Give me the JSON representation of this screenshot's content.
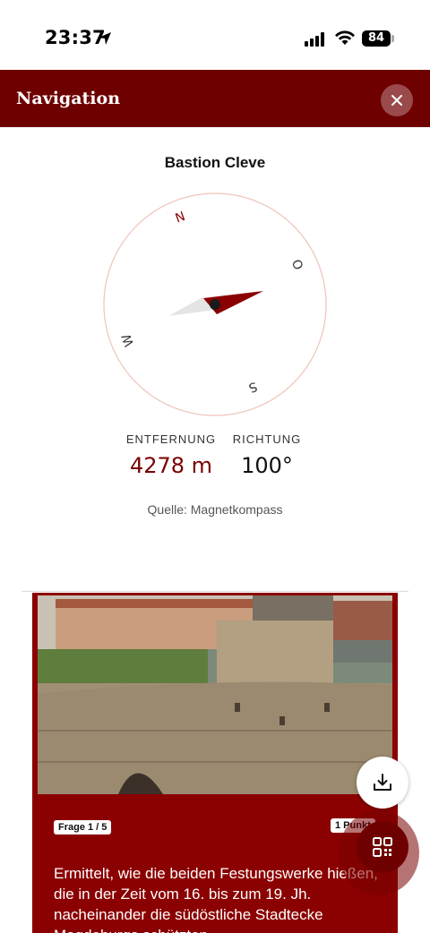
{
  "status_bar": {
    "time": "23:37",
    "battery": "84"
  },
  "header": {
    "title": "Navigation",
    "close_icon": "close-icon"
  },
  "target": {
    "name": "Bastion Cleve"
  },
  "compass": {
    "directions": {
      "n": "N",
      "o": "O",
      "s": "S",
      "w": "W"
    },
    "accent_color": "#8b0000"
  },
  "stats": {
    "distance_label": "ENTFERNUNG",
    "distance_value": "4278 m",
    "direction_label": "RICHTUNG",
    "direction_value": "100°"
  },
  "source": "Quelle: Magnetkompass",
  "card": {
    "question_badge": "Frage 1 / 5",
    "points_badge": "1 Punkt",
    "question_text": "Ermittelt, wie die beiden Festungswerke hießen, die in der Zeit vom 16. bis zum 19. Jh. nacheinander die südöstliche Stadtecke Magdeburgs schützten."
  },
  "colors": {
    "brand": "#6e0000",
    "card": "#8b0000"
  }
}
